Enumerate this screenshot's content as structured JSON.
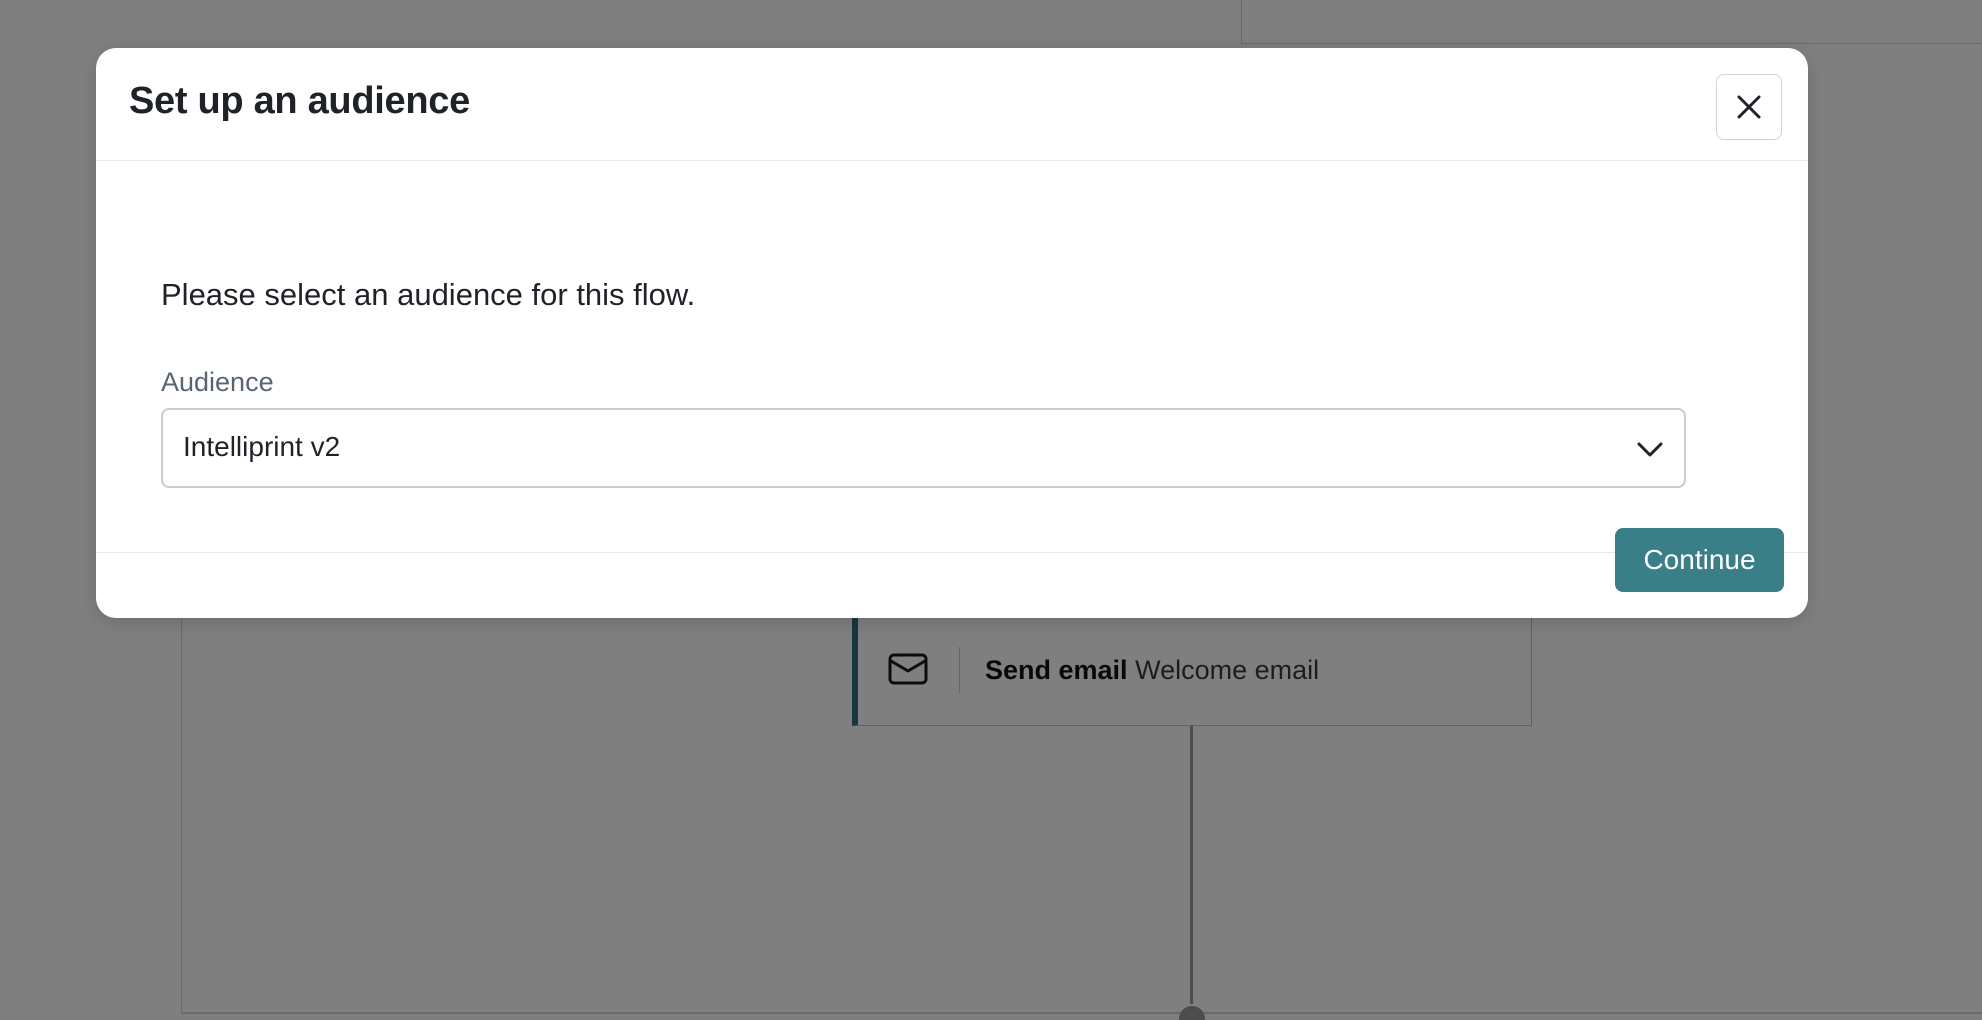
{
  "modal": {
    "title": "Set up an audience",
    "prompt": "Please select an audience for this flow.",
    "audience_label": "Audience",
    "audience_value": "Intelliprint v2",
    "continue_label": "Continue",
    "close_icon": "close-icon",
    "dropdown_icon": "chevron-down-icon"
  },
  "flow": {
    "card": {
      "action": "Send email",
      "email_name": "Welcome email",
      "icon": "envelope-icon",
      "accent_color": "#2f6f78"
    }
  },
  "colors": {
    "primary_button": "#3a7e87",
    "overlay": "rgba(0,0,0,0.5)"
  }
}
